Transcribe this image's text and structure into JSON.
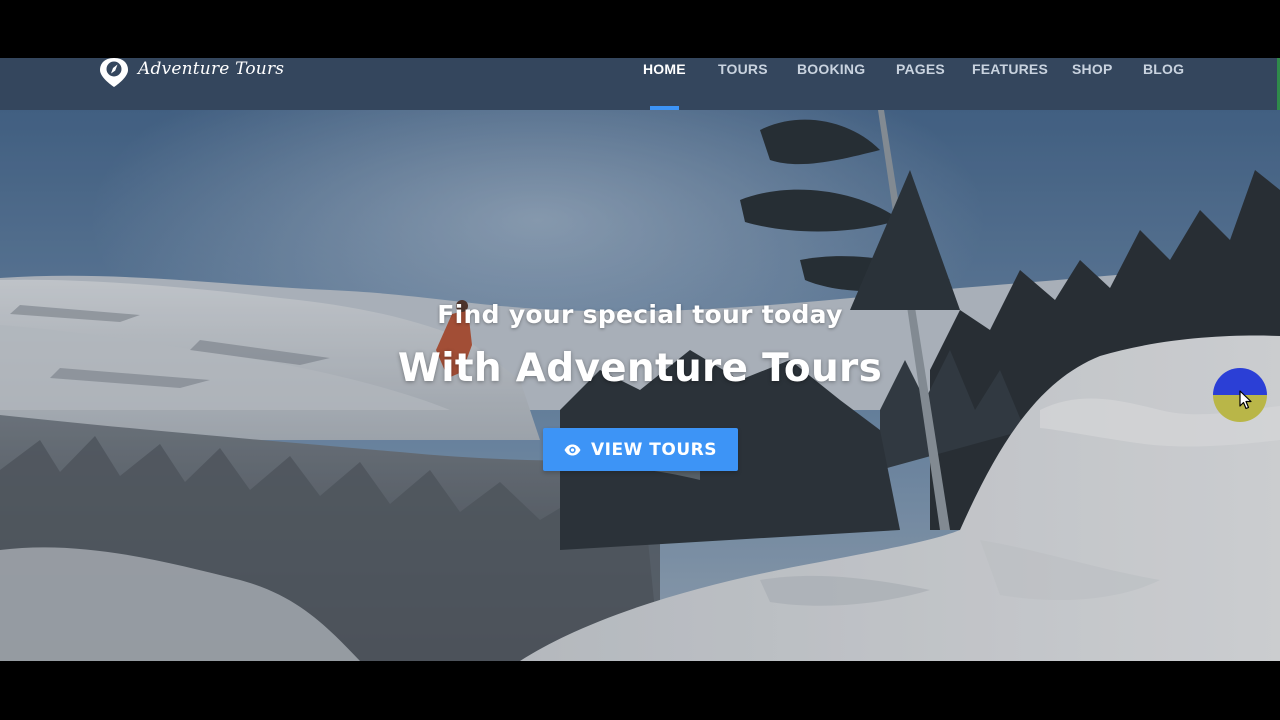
{
  "brand": {
    "name": "Adventure Tours",
    "logo_icon": "compass-pin-icon"
  },
  "nav": {
    "items": [
      {
        "label": "HOME",
        "active": true
      },
      {
        "label": "TOURS"
      },
      {
        "label": "BOOKING"
      },
      {
        "label": "PAGES"
      },
      {
        "label": "FEATURES"
      },
      {
        "label": "SHOP"
      },
      {
        "label": "BLOG"
      }
    ]
  },
  "hero": {
    "subtitle": "Find your special tour today",
    "title": "With Adventure Tours",
    "cta": {
      "label": "VIEW TOURS",
      "icon": "eye-icon"
    }
  },
  "colors": {
    "header_bg": "#34465d",
    "accent": "#3d94f6",
    "nav_text": "#c9d3df",
    "nav_active": "#ffffff"
  }
}
